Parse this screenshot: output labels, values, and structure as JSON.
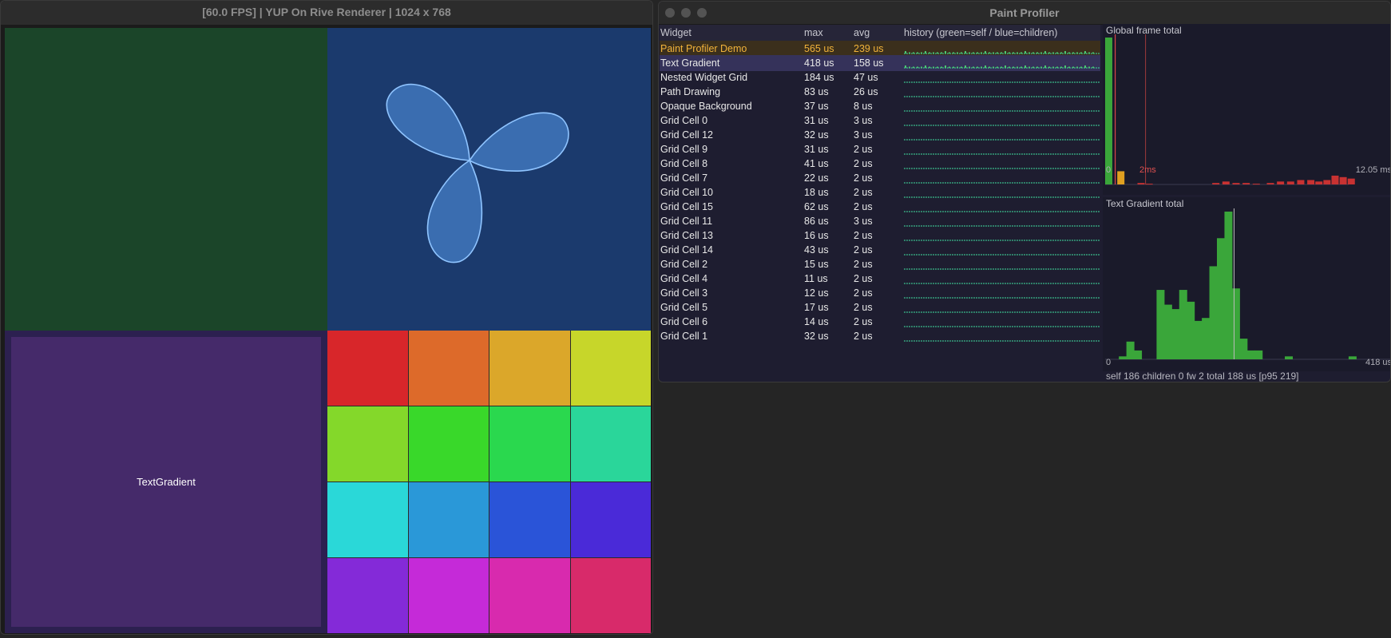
{
  "left_window": {
    "title": "[60.0 FPS] | YUP On Rive Renderer | 1024 x 768",
    "text_gradient_label": "TextGradient",
    "grid_colors": [
      "#d8262a",
      "#dd6a2a",
      "#dba72a",
      "#c7d62a",
      "#84d82a",
      "#39d82a",
      "#2ad84e",
      "#2ad69a",
      "#2ad8d8",
      "#2a98d8",
      "#2a54d8",
      "#4a2ad8",
      "#842ad8",
      "#c52ad8",
      "#d82aae",
      "#d82a6a"
    ],
    "colors": {
      "green_tile": "#1b4529",
      "blue_tile": "#1b3a6d",
      "purple_tile": "#452a6a",
      "petal_fill": "#3a6db0",
      "petal_stroke": "#8fc4ff"
    }
  },
  "right_window": {
    "title": "Paint Profiler",
    "columns": {
      "widget": "Widget",
      "max": "max",
      "avg": "avg",
      "history": "history (green=self / blue=children)"
    },
    "rows": [
      {
        "name": "Paint Profiler Demo",
        "max": "565 us",
        "avg": "239 us",
        "state": "highlighted"
      },
      {
        "name": "Text Gradient",
        "max": "418 us",
        "avg": "158 us",
        "state": "selected"
      },
      {
        "name": "Nested Widget Grid",
        "max": "184 us",
        "avg": "47 us",
        "state": "normal"
      },
      {
        "name": "Path Drawing",
        "max": "83 us",
        "avg": "26 us",
        "state": "normal"
      },
      {
        "name": "Opaque Background",
        "max": "37 us",
        "avg": "8 us",
        "state": "normal"
      },
      {
        "name": "Grid Cell 0",
        "max": "31 us",
        "avg": "3 us",
        "state": "normal"
      },
      {
        "name": "Grid Cell 12",
        "max": "32 us",
        "avg": "3 us",
        "state": "normal"
      },
      {
        "name": "Grid Cell 9",
        "max": "31 us",
        "avg": "2 us",
        "state": "normal"
      },
      {
        "name": "Grid Cell 8",
        "max": "41 us",
        "avg": "2 us",
        "state": "normal"
      },
      {
        "name": "Grid Cell 7",
        "max": "22 us",
        "avg": "2 us",
        "state": "normal"
      },
      {
        "name": "Grid Cell 10",
        "max": "18 us",
        "avg": "2 us",
        "state": "normal"
      },
      {
        "name": "Grid Cell 15",
        "max": "62 us",
        "avg": "2 us",
        "state": "normal"
      },
      {
        "name": "Grid Cell 11",
        "max": "86 us",
        "avg": "3 us",
        "state": "normal"
      },
      {
        "name": "Grid Cell 13",
        "max": "16 us",
        "avg": "2 us",
        "state": "normal"
      },
      {
        "name": "Grid Cell 14",
        "max": "43 us",
        "avg": "2 us",
        "state": "normal"
      },
      {
        "name": "Grid Cell 2",
        "max": "15 us",
        "avg": "2 us",
        "state": "normal"
      },
      {
        "name": "Grid Cell 4",
        "max": "11 us",
        "avg": "2 us",
        "state": "normal"
      },
      {
        "name": "Grid Cell 3",
        "max": "12 us",
        "avg": "2 us",
        "state": "normal"
      },
      {
        "name": "Grid Cell 5",
        "max": "17 us",
        "avg": "2 us",
        "state": "normal"
      },
      {
        "name": "Grid Cell 6",
        "max": "14 us",
        "avg": "2 us",
        "state": "normal"
      },
      {
        "name": "Grid Cell 1",
        "max": "32 us",
        "avg": "2 us",
        "state": "normal"
      }
    ],
    "global_chart": {
      "title": "Global frame total",
      "x_min_label": "0",
      "marker_label": "2ms",
      "x_max_label": "12.05 ms"
    },
    "widget_chart": {
      "title": "Text Gradient total",
      "x_min_label": "0",
      "x_max_label": "418 us"
    },
    "status": "self 186  children 0  fw 2  total 188 us  [p95 219]",
    "colors": {
      "highlight_row": "#3b2f1c",
      "highlight_text": "#f2b33a",
      "selected_row": "#35325a",
      "bar_green": "#3aa63a",
      "bar_orange": "#e0a020",
      "bar_red": "#c83232",
      "history_line": "#3ab88a"
    }
  },
  "chart_data": [
    {
      "type": "bar",
      "title": "Global frame total",
      "xlabel": "",
      "ylabel": "",
      "x_tick_labels": [
        "0",
        "2ms",
        "12.05 ms"
      ],
      "xlim": [
        0,
        12.05
      ],
      "x_unit": "ms",
      "bins": [
        {
          "x": 0.0,
          "count": 100,
          "color": "green"
        },
        {
          "x": 0.6,
          "count": 9,
          "color": "orange"
        },
        {
          "x": 1.6,
          "count": 1,
          "color": "red"
        },
        {
          "x": 2.0,
          "count": 0.5,
          "color": "red"
        },
        {
          "x": 5.3,
          "count": 1,
          "color": "red"
        },
        {
          "x": 5.8,
          "count": 2,
          "color": "red"
        },
        {
          "x": 6.3,
          "count": 1,
          "color": "red"
        },
        {
          "x": 6.8,
          "count": 1,
          "color": "red"
        },
        {
          "x": 7.3,
          "count": 0.5,
          "color": "red"
        },
        {
          "x": 8.0,
          "count": 1,
          "color": "red"
        },
        {
          "x": 8.5,
          "count": 2,
          "color": "red"
        },
        {
          "x": 9.0,
          "count": 2,
          "color": "red"
        },
        {
          "x": 9.5,
          "count": 3,
          "color": "red"
        },
        {
          "x": 10.0,
          "count": 3,
          "color": "red"
        },
        {
          "x": 10.4,
          "count": 2,
          "color": "red"
        },
        {
          "x": 10.8,
          "count": 3,
          "color": "red"
        },
        {
          "x": 11.2,
          "count": 6,
          "color": "red"
        },
        {
          "x": 11.6,
          "count": 5,
          "color": "red"
        },
        {
          "x": 12.0,
          "count": 4,
          "color": "red"
        }
      ],
      "markers": [
        0.5,
        2.0
      ]
    },
    {
      "type": "bar",
      "title": "Text Gradient total",
      "xlabel": "",
      "ylabel": "",
      "x_tick_labels": [
        "0",
        "418 us"
      ],
      "xlim": [
        0,
        418
      ],
      "x_unit": "us",
      "bins": [
        {
          "x": 20,
          "count": 2
        },
        {
          "x": 31,
          "count": 12
        },
        {
          "x": 42,
          "count": 6
        },
        {
          "x": 75,
          "count": 47
        },
        {
          "x": 86,
          "count": 37
        },
        {
          "x": 97,
          "count": 34
        },
        {
          "x": 108,
          "count": 47
        },
        {
          "x": 119,
          "count": 39
        },
        {
          "x": 130,
          "count": 26
        },
        {
          "x": 141,
          "count": 28
        },
        {
          "x": 152,
          "count": 63
        },
        {
          "x": 163,
          "count": 82
        },
        {
          "x": 174,
          "count": 100
        },
        {
          "x": 185,
          "count": 48
        },
        {
          "x": 196,
          "count": 14
        },
        {
          "x": 207,
          "count": 6
        },
        {
          "x": 218,
          "count": 6
        },
        {
          "x": 262,
          "count": 2
        },
        {
          "x": 355,
          "count": 2
        }
      ],
      "markers": [
        188
      ]
    }
  ]
}
